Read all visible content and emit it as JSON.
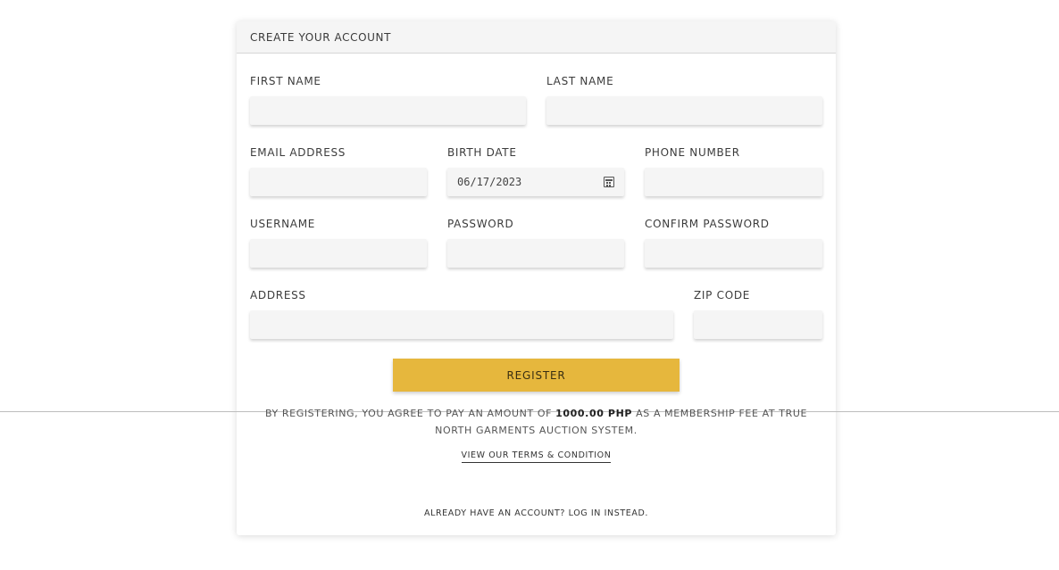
{
  "form": {
    "header": "CREATE YOUR ACCOUNT",
    "first_name_label": "FIRST NAME",
    "last_name_label": "LAST NAME",
    "email_label": "EMAIL ADDRESS",
    "birth_date_label": "BIRTH DATE",
    "birth_date_value": "06/17/2023",
    "phone_label": "PHONE NUMBER",
    "username_label": "USERNAME",
    "password_label": "PASSWORD",
    "confirm_password_label": "CONFIRM PASSWORD",
    "address_label": "ADDRESS",
    "zip_label": "ZIP CODE",
    "register_label": "REGISTER",
    "notice_before": "BY REGISTERING, YOU AGREE TO PAY AN AMOUNT OF ",
    "notice_amount": "1000.00 PHP",
    "notice_after": " AS A MEMBERSHIP FEE AT TRUE NORTH GARMENTS AUCTION SYSTEM.",
    "terms_link": "VIEW OUR TERMS & CONDITION",
    "login_link": "ALREADY HAVE AN ACCOUNT? LOG IN INSTEAD."
  },
  "colors": {
    "accent": "#e6b73d",
    "field_bg": "#f5f5f5"
  }
}
